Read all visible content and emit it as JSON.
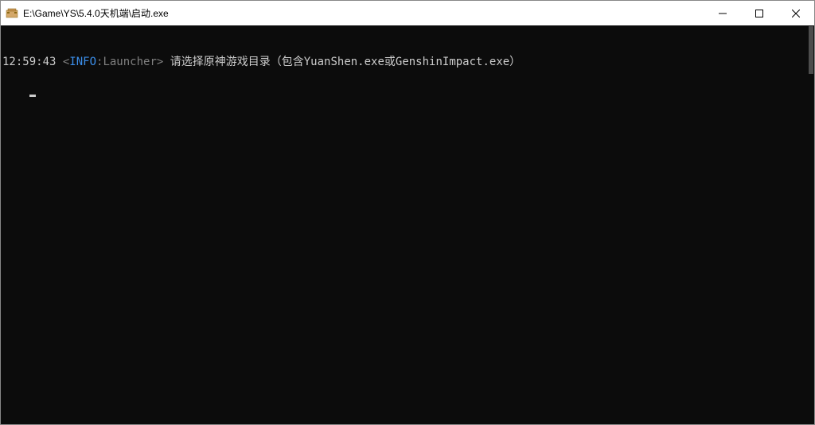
{
  "window": {
    "title": "E:\\Game\\YS\\5.4.0天机端\\启动.exe"
  },
  "console": {
    "lines": [
      {
        "timestamp": "12:59:43",
        "bracket_open": " <",
        "level": "INFO",
        "sep": ":",
        "source": "Launcher",
        "bracket_close": "> ",
        "message": "请选择原神游戏目录（包含YuanShen.exe或GenshinImpact.exe）"
      }
    ]
  }
}
